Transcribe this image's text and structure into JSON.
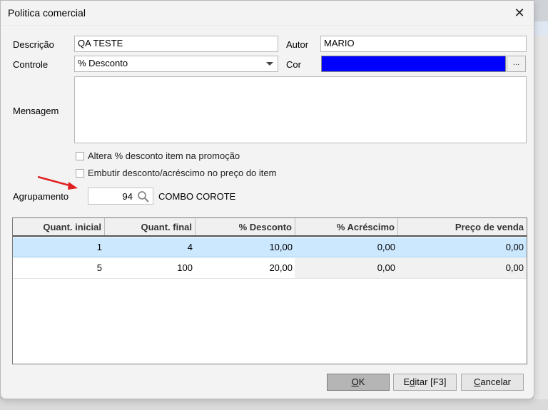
{
  "window": {
    "title": "Politica comercial"
  },
  "labels": {
    "descricao": "Descrição",
    "autor": "Autor",
    "controle": "Controle",
    "cor": "Cor",
    "mensagem": "Mensagem",
    "agrupamento": "Agrupamento"
  },
  "fields": {
    "descricao": "QA TESTE",
    "autor": "MARIO",
    "controle": "% Desconto",
    "cor_color": "#0000ff",
    "cor_button": "...",
    "mensagem": "",
    "agrupamento_code": "94",
    "agrupamento_name": "COMBO COROTE"
  },
  "checkboxes": [
    {
      "label": "Altera % desconto item na promoção",
      "checked": false
    },
    {
      "label": "Embutir desconto/acréscimo no preço do item",
      "checked": false
    }
  ],
  "table": {
    "columns": [
      "Quant. inicial",
      "Quant. final",
      "% Desconto",
      "% Acréscimo",
      "Preço de venda"
    ],
    "rows": [
      [
        "1",
        "4",
        "10,00",
        "0,00",
        "0,00"
      ],
      [
        "5",
        "100",
        "20,00",
        "0,00",
        "0,00"
      ]
    ],
    "selected_row": 0
  },
  "buttons": {
    "ok_u": "O",
    "ok_rest": "K",
    "editar_pre": "E",
    "editar_u": "d",
    "editar_rest": "itar [F3]",
    "cancelar_u": "C",
    "cancelar_rest": "ancelar"
  },
  "icons": {
    "close": "close-icon",
    "search": "search-icon",
    "dropdown": "chevron-down-icon",
    "annotation": "red-arrow-icon"
  }
}
